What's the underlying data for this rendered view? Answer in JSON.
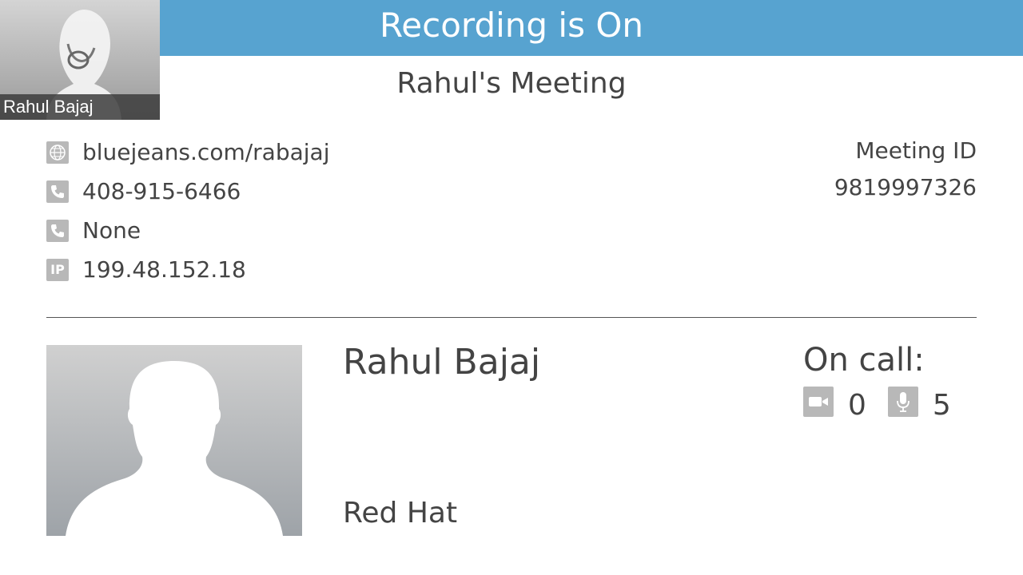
{
  "banner": {
    "text": "Recording is On"
  },
  "self_view": {
    "name": "Rahul Bajaj"
  },
  "meeting": {
    "title": "Rahul's Meeting",
    "id_label": "Meeting ID",
    "id_value": "9819997326"
  },
  "info": [
    {
      "icon": "globe-icon",
      "text": "bluejeans.com/rabajaj"
    },
    {
      "icon": "phone-icon",
      "text": "408-915-6466"
    },
    {
      "icon": "phone-icon",
      "text": "None"
    },
    {
      "icon": "ip-icon",
      "icon_text": "IP",
      "text": "199.48.152.18"
    }
  ],
  "organizer": {
    "name": "Rahul Bajaj",
    "company": "Red Hat"
  },
  "on_call": {
    "label": "On call:",
    "video_count": "0",
    "audio_count": "5"
  },
  "colors": {
    "banner": "#57a3d0",
    "icon_bg": "#b8b8b8",
    "text": "#444444"
  }
}
